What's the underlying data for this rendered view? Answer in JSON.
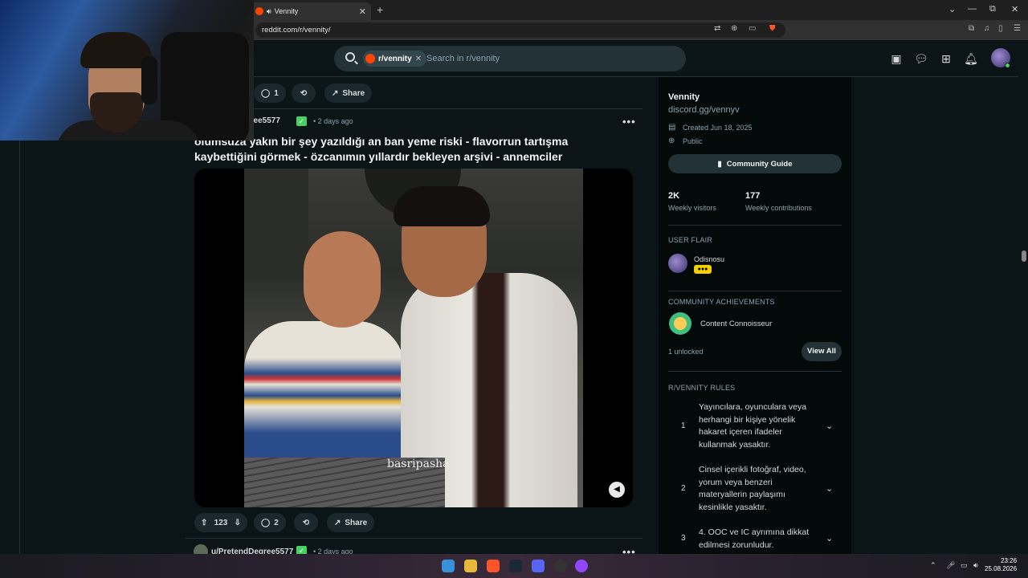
{
  "browser": {
    "tab_title": "Vennity",
    "tab_audio_icon": "speaker-icon",
    "new_tab": "+",
    "url": "reddit.com/r/vennity/",
    "window_controls": [
      "⌄",
      "—",
      "⧉",
      "✕"
    ]
  },
  "header": {
    "community_chip": "r/vennity",
    "chip_remove": "✕",
    "search_placeholder": "Search in r/vennity",
    "icons": [
      "ads-icon",
      "chat-icon",
      "create-post-icon",
      "notifications-icon",
      "avatar"
    ]
  },
  "prev_post": {
    "comments": "1",
    "share": "Share"
  },
  "post": {
    "author": "u/PretendDegree5577",
    "author_visible": "egree5577",
    "flair": "✓",
    "time": "• 2 days ago",
    "more": "•••",
    "title": "olumsuza yakın bir şey yazıldığı an ban yeme riski - flavorrun tartışma kaybettiğini görmek - özcanımın yıllardır bekleyen arşivi - annemciler",
    "watermark": "basripasha",
    "votes": "123",
    "comments": "2",
    "share": "Share"
  },
  "next_post": {
    "author": "u/PretendDegree5577",
    "flair": "✓",
    "time": "• 2 days ago",
    "more": "•••"
  },
  "sidebar": {
    "name": "Vennity",
    "link": "discord.gg/vennyv",
    "created": "Created Jun 18, 2025",
    "visibility": "Public",
    "guide_button": "Community Guide",
    "stats": [
      {
        "value": "2K",
        "label": "Weekly visitors"
      },
      {
        "value": "177",
        "label": "Weekly contributions"
      }
    ],
    "user_flair_heading": "USER FLAIR",
    "user_flair_name": "Odisnosu",
    "user_flair_badge": "●●●",
    "achievements_heading": "COMMUNITY ACHIEVEMENTS",
    "achievement_name": "Content Connoisseur",
    "achievement_unlocked": "1 unlocked",
    "view_all": "View All",
    "rules_heading": "R/VENNITY RULES",
    "rules": [
      {
        "num": "1",
        "text": "Yayıncılara, oyunculara veya herhangi bir kişiye yönelik hakaret içeren ifadeler kullanmak yasaktır."
      },
      {
        "num": "2",
        "text": "Cinsel içerikli fotoğraf, video, yorum veya benzeri materyallerin paylaşımı kesinlikle yasaktır."
      },
      {
        "num": "3",
        "text": "4. OOC ve IC ayrımına dikkat edilmesi zorunludur."
      }
    ]
  },
  "taskbar": {
    "time": "23:26",
    "date": "25.08.2026"
  },
  "colors": {
    "background": "#0b1416",
    "sidebar": "#04090a",
    "accent_green": "#46d160",
    "reddit_orange": "#ff4500"
  }
}
